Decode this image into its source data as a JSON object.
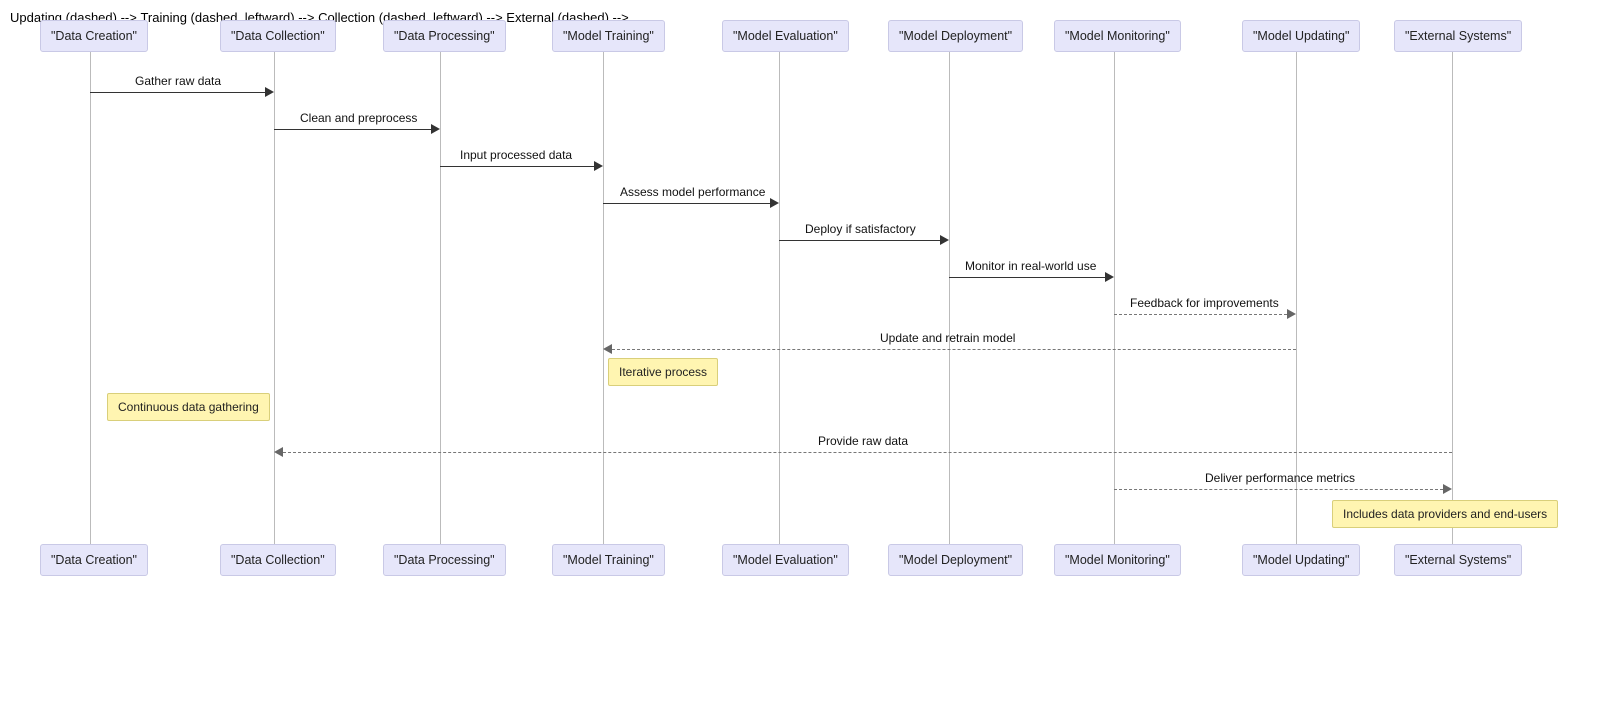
{
  "actors": [
    "\"Data Creation\"",
    "\"Data Collection\"",
    "\"Data Processing\"",
    "\"Model Training\"",
    "\"Model Evaluation\"",
    "\"Model Deployment\"",
    "\"Model Monitoring\"",
    "\"Model Updating\"",
    "\"External Systems\""
  ],
  "messages": {
    "m1": "Gather raw data",
    "m2": "Clean and preprocess",
    "m3": "Input processed data",
    "m4": "Assess model performance",
    "m5": "Deploy if satisfactory",
    "m6": "Monitor in real-world use",
    "m7": "Feedback for improvements",
    "m8": "Update and retrain model",
    "m9": "Provide raw data",
    "m10": "Deliver performance metrics"
  },
  "notes": {
    "n1": "Iterative process",
    "n2": "Continuous data gathering",
    "n3": "Includes data providers and end-users"
  }
}
